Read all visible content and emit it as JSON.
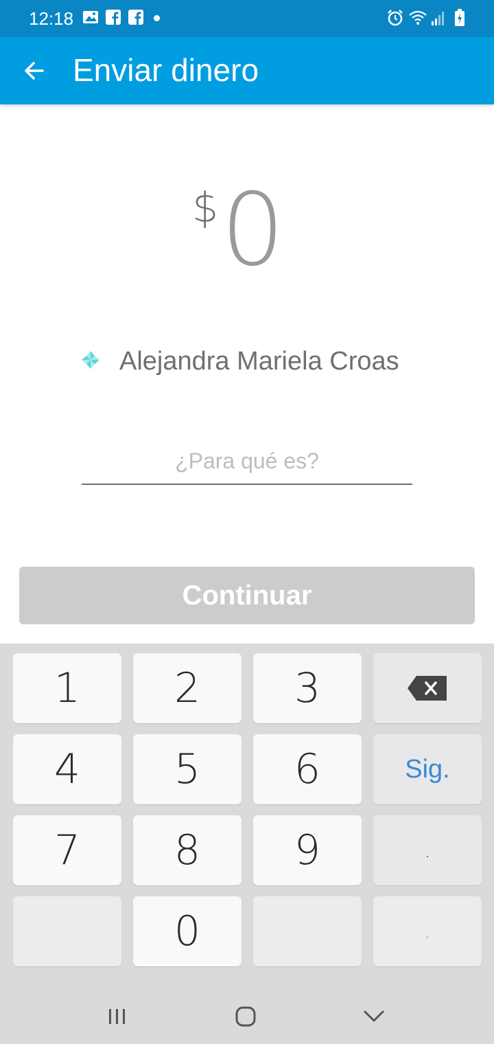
{
  "status_bar": {
    "time": "12:18",
    "icons": [
      "image-icon",
      "facebook-icon",
      "facebook-icon",
      "alarm-icon",
      "wifi-icon",
      "signal-icon",
      "battery-icon"
    ]
  },
  "app_bar": {
    "title": "Enviar dinero",
    "back_icon": "arrow-left-icon"
  },
  "amount": {
    "currency": "$",
    "value": "0"
  },
  "recipient": {
    "name": "Alejandra Mariela Croas"
  },
  "note": {
    "placeholder": "¿Para qué es?",
    "value": ""
  },
  "continue_button": {
    "label": "Continuar"
  },
  "keyboard": {
    "keys": [
      "1",
      "2",
      "3",
      "4",
      "5",
      "6",
      "7",
      "8",
      "9",
      "0"
    ],
    "next_label": "Sig.",
    "dot_label": ".",
    "comma_label": ","
  },
  "colors": {
    "primary": "#009de0",
    "status_bar": "#0b86c4",
    "button_disabled": "#cccccc",
    "keyboard_bg": "#dadada",
    "accent_blue": "#3b88d8"
  }
}
